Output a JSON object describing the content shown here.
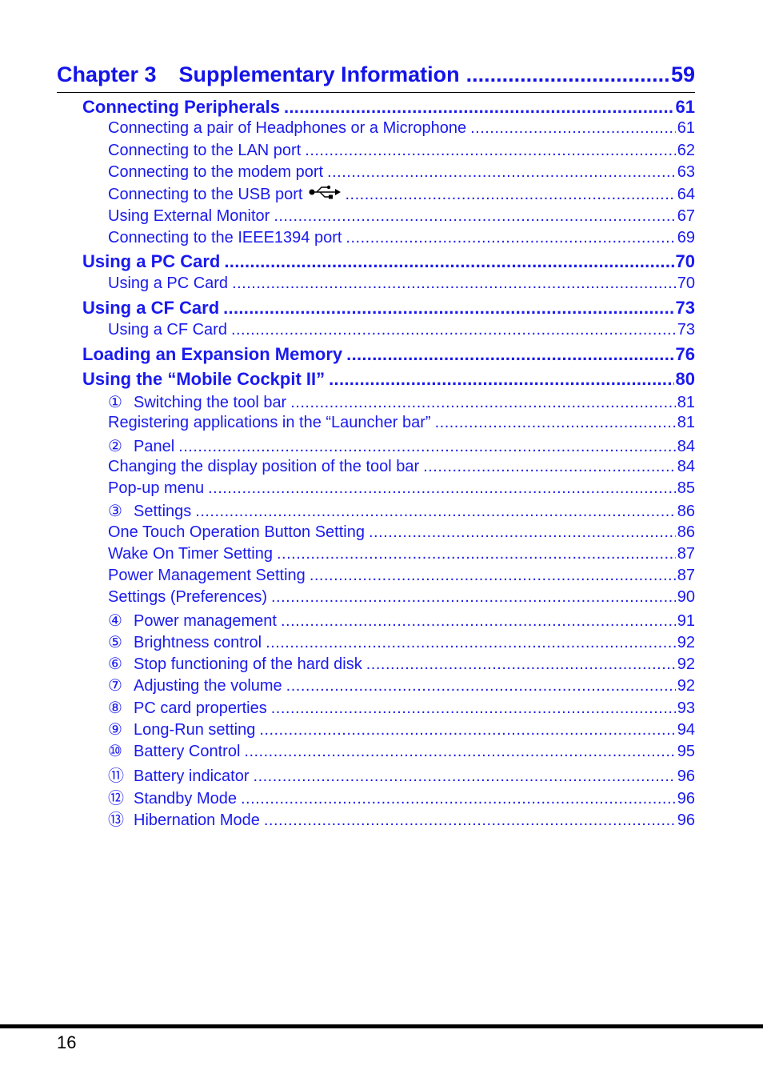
{
  "chapter": {
    "number": "Chapter 3",
    "title": "Supplementary Information",
    "page": "59"
  },
  "entries": [
    {
      "level": 1,
      "label": "Connecting Peripherals",
      "page": "61"
    },
    {
      "level": 2,
      "label": "Connecting a pair of Headphones or a Microphone",
      "page": "61"
    },
    {
      "level": 2,
      "label": "Connecting to the LAN port",
      "page": "62"
    },
    {
      "level": 2,
      "label": "Connecting to the modem port",
      "page": "63"
    },
    {
      "level": 2,
      "label": "Connecting to the USB port",
      "icon": "usb-icon",
      "page": "64"
    },
    {
      "level": 2,
      "label": "Using External Monitor",
      "page": "67"
    },
    {
      "level": 2,
      "label": "Connecting to the IEEE1394 port",
      "page": "69"
    },
    {
      "level": 1,
      "label": "Using a PC Card",
      "page": "70"
    },
    {
      "level": 2,
      "label": "Using a PC Card",
      "page": "70"
    },
    {
      "level": 1,
      "label": "Using a CF Card",
      "page": "73"
    },
    {
      "level": 2,
      "label": "Using a CF Card",
      "page": "73"
    },
    {
      "level": 1,
      "label": "Loading an Expansion Memory",
      "page": "76"
    },
    {
      "level": 1,
      "label": "Using the “Mobile Cockpit II”",
      "page": "80"
    },
    {
      "level": 2,
      "marker": "①",
      "label": "Switching the tool bar",
      "page": "81"
    },
    {
      "level": 2,
      "label": "Registering applications in the “Launcher bar”",
      "page": "81"
    },
    {
      "level": 2,
      "marker": "②",
      "label": "Panel",
      "page": "84"
    },
    {
      "level": 2,
      "label": "Changing the display position of the tool bar",
      "page": "84"
    },
    {
      "level": 2,
      "label": "Pop-up menu",
      "page": "85"
    },
    {
      "level": 2,
      "marker": "③",
      "label": "Settings",
      "page": "86"
    },
    {
      "level": 2,
      "label": "One Touch Operation Button Setting",
      "page": "86"
    },
    {
      "level": 2,
      "label": "Wake On Timer Setting",
      "page": "87"
    },
    {
      "level": 2,
      "label": "Power Management Setting",
      "page": "87"
    },
    {
      "level": 2,
      "label": "Settings (Preferences)",
      "page": "90"
    },
    {
      "level": 2,
      "marker": "④",
      "label": "Power management",
      "page": "91"
    },
    {
      "level": 2,
      "marker": "⑤",
      "label": "Brightness control",
      "page": "92"
    },
    {
      "level": 2,
      "marker": "⑥",
      "label": "Stop functioning of the hard disk",
      "page": "92"
    },
    {
      "level": 2,
      "marker": "⑦",
      "label": "Adjusting the volume",
      "page": "92"
    },
    {
      "level": 2,
      "marker": "⑧",
      "label": "PC card properties",
      "page": "93"
    },
    {
      "level": 2,
      "marker": "⑨",
      "label": "Long-Run setting",
      "page": "94"
    },
    {
      "level": 2,
      "marker": "⑩",
      "label": "Battery Control",
      "page": "95"
    },
    {
      "level": 2,
      "marker": "⑪",
      "label": "Battery indicator",
      "page": "96"
    },
    {
      "level": 2,
      "marker": "⑫",
      "label": "Standby Mode",
      "page": "96"
    },
    {
      "level": 2,
      "marker": "⑬",
      "label": "Hibernation Mode",
      "page": "96"
    }
  ],
  "footer": {
    "page_number": "16"
  },
  "colors": {
    "link": "#1a1aee",
    "chapter": "#1414e8",
    "rule": "#000000"
  }
}
